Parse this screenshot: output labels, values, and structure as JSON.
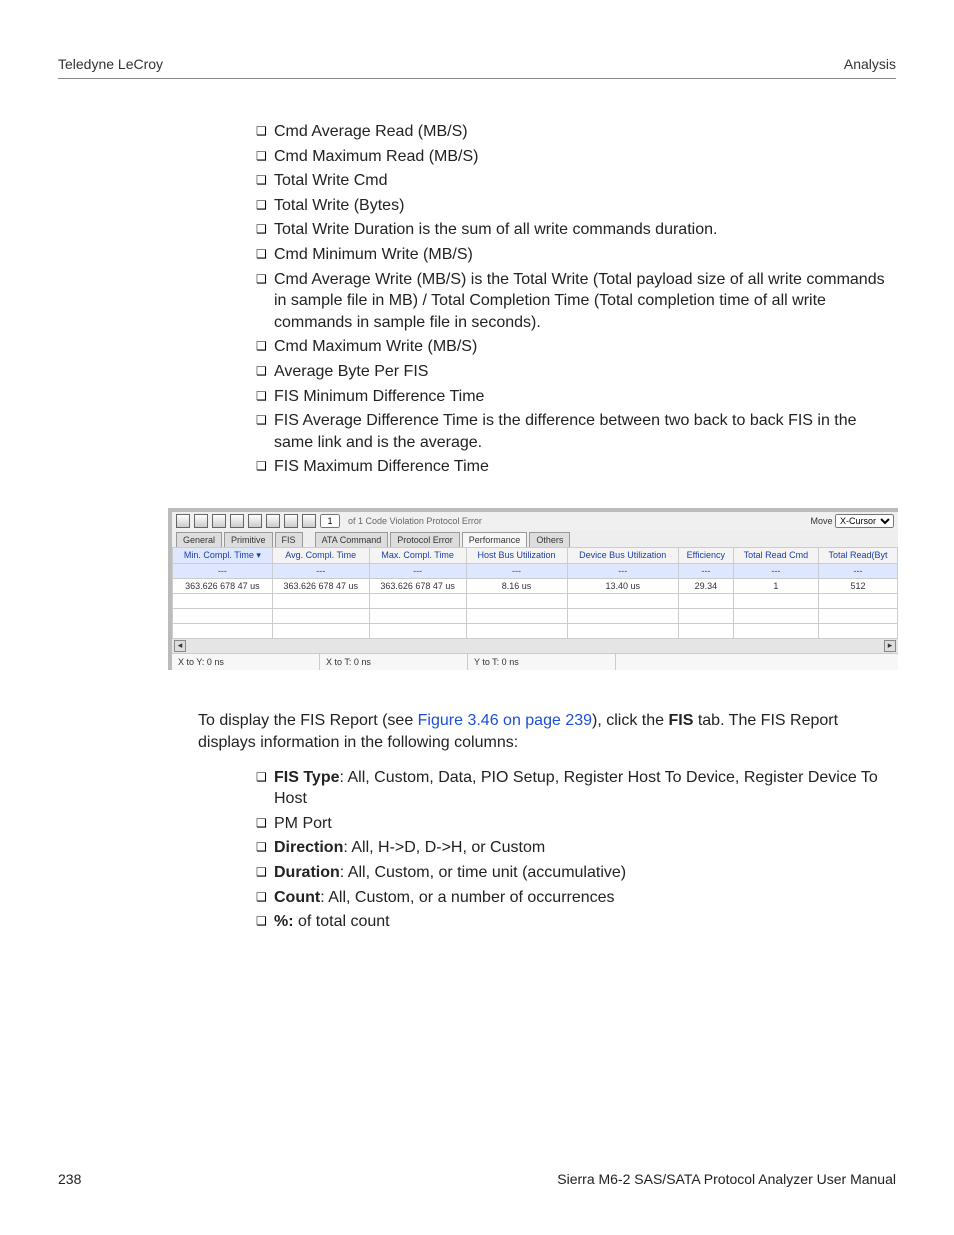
{
  "header": {
    "left": "Teledyne LeCroy",
    "right": "Analysis"
  },
  "bullets_top": [
    "Cmd Average Read (MB/S)",
    "Cmd Maximum Read (MB/S)",
    "Total Write Cmd",
    "Total Write (Bytes)",
    "Total Write Duration is the sum of all write commands duration.",
    "Cmd Minimum Write (MB/S)",
    "Cmd Average Write (MB/S) is the Total Write (Total payload size of all write commands in sample file in MB) / Total Completion Time (Total completion time of all write commands in sample file in seconds).",
    "Cmd Maximum Write (MB/S)",
    "Average Byte Per FIS",
    "FIS Minimum Difference Time",
    "FIS Average Difference Time is the difference between two back to back FIS in the same link and is the average.",
    "FIS Maximum Difference Time"
  ],
  "figure": {
    "toolbar": {
      "navtext": "of 1  Code Violation  Protocol Error",
      "move_label": "Move",
      "move_value": "X-Cursor"
    },
    "tabs_left": [
      "General",
      "Primitive",
      "FIS"
    ],
    "tabs_right": [
      "ATA Command",
      "Protocol Error",
      "Performance",
      "Others"
    ],
    "active_tab": "Performance",
    "columns": [
      "Min. Compl. Time",
      "Avg. Compl. Time",
      "Max. Compl. Time",
      "Host Bus Utilization",
      "Device Bus Utilization",
      "Efficiency",
      "Total Read Cmd",
      "Total Read(Byt"
    ],
    "sort_row": [
      "---",
      "---",
      "---",
      "---",
      "---",
      "---",
      "---",
      "---"
    ],
    "data_row": [
      "363.626 678 47  us",
      "363.626 678 47  us",
      "363.626 678 47  us",
      "8.16  us",
      "13.40  us",
      "29.34",
      "1",
      "512"
    ],
    "status": [
      "X to Y: 0 ns",
      "X to T: 0 ns",
      "Y to T: 0 ns"
    ]
  },
  "para": {
    "pre": "To display the FIS Report (see ",
    "link": "Figure 3.46 on page 239",
    "mid": "), click the ",
    "bold": "FIS",
    "post": " tab. The FIS Report displays information in the following columns:"
  },
  "bullets_bottom": [
    {
      "b": "FIS Type",
      "t": ": All, Custom, Data, PIO Setup, Register Host To Device, Register Device To Host"
    },
    {
      "b": "",
      "t": "PM Port"
    },
    {
      "b": "Direction",
      "t": ": All, H->D, D->H, or Custom"
    },
    {
      "b": "Duration",
      "t": ": All, Custom, or time unit (accumulative)"
    },
    {
      "b": "Count",
      "t": ": All, Custom, or a number of occurrences"
    },
    {
      "b": "%:",
      "t": " of total count"
    }
  ],
  "footer": {
    "left": "238",
    "right": "Sierra M6-2 SAS/SATA Protocol Analyzer User Manual"
  }
}
